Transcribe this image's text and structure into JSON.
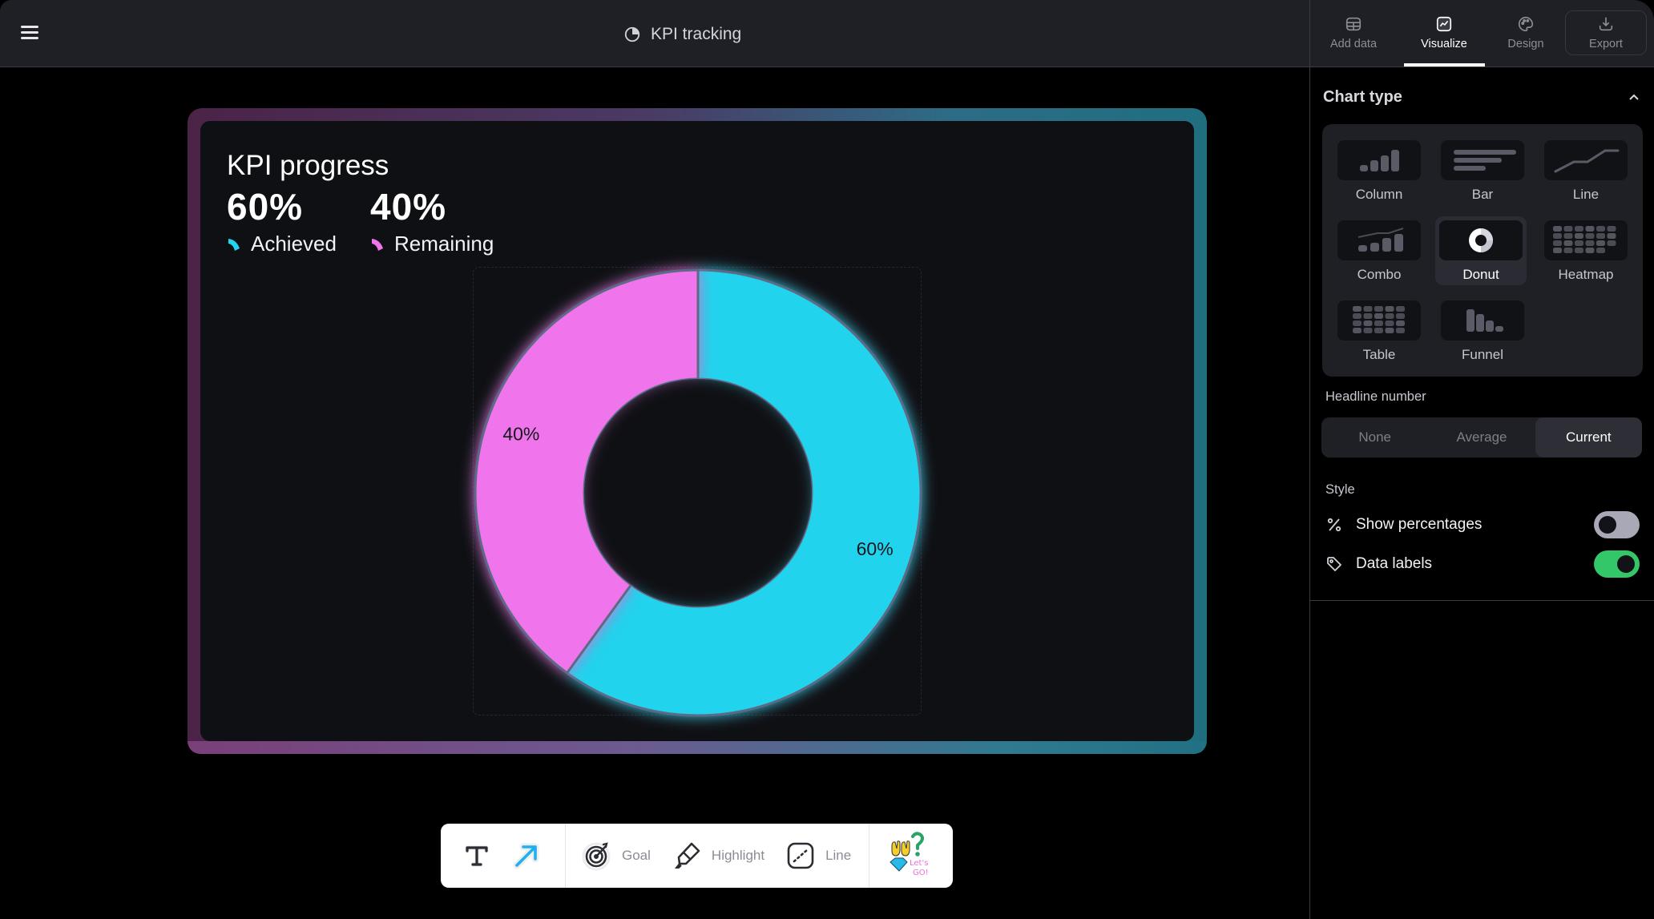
{
  "header": {
    "menu_icon": "hamburger-icon",
    "doc_icon": "pie-chart-icon",
    "title": "KPI tracking"
  },
  "panel_tabs": [
    {
      "label": "Add data",
      "icon": "table-icon",
      "active": false
    },
    {
      "label": "Visualize",
      "icon": "line-chart-icon",
      "active": true
    },
    {
      "label": "Design",
      "icon": "palette-icon",
      "active": false
    },
    {
      "label": "Export",
      "icon": "download-icon",
      "active": false
    }
  ],
  "chart_type": {
    "title": "Chart type",
    "collapse_icon": "chevron-up-icon",
    "options": [
      {
        "label": "Column",
        "selected": false
      },
      {
        "label": "Bar",
        "selected": false
      },
      {
        "label": "Line",
        "selected": false
      },
      {
        "label": "Combo",
        "selected": false
      },
      {
        "label": "Donut",
        "selected": true
      },
      {
        "label": "Heatmap",
        "selected": false
      },
      {
        "label": "Table",
        "selected": false
      },
      {
        "label": "Funnel",
        "selected": false
      }
    ]
  },
  "headline_number": {
    "label": "Headline number",
    "options": [
      "None",
      "Average",
      "Current"
    ],
    "selected": "Current"
  },
  "style": {
    "label": "Style",
    "options": [
      {
        "label": "Show percentages",
        "icon": "percent-icon",
        "enabled": false
      },
      {
        "label": "Data labels",
        "icon": "tag-icon",
        "enabled": true
      }
    ]
  },
  "card": {
    "title": "KPI progress",
    "kpis": [
      {
        "value": "60%",
        "label": "Achieved",
        "color": "#22d3ee"
      },
      {
        "value": "40%",
        "label": "Remaining",
        "color": "#f075ec"
      }
    ]
  },
  "chart_data": {
    "type": "pie",
    "variant": "donut",
    "title": "KPI progress",
    "categories": [
      "Achieved",
      "Remaining"
    ],
    "values": [
      60,
      40
    ],
    "unit": "%",
    "colors": [
      "#22d3ee",
      "#f075ec"
    ],
    "data_labels": [
      "60%",
      "40%"
    ],
    "start_angle_deg": 0,
    "direction": "clockwise",
    "legend": "top-left"
  },
  "toolbar": {
    "items": [
      {
        "label": "",
        "icon": "text-tool-icon"
      },
      {
        "label": "",
        "icon": "arrow-tool-icon"
      },
      {
        "label": "Goal",
        "icon": "target-icon"
      },
      {
        "label": "Highlight",
        "icon": "highlighter-icon"
      },
      {
        "label": "Line",
        "icon": "dotted-line-icon"
      },
      {
        "label": "",
        "icon": "stickers-icon"
      }
    ]
  },
  "colors": {
    "accent_cyan": "#22d3ee",
    "accent_pink": "#f075ec",
    "toggle_on": "#33c76a",
    "toggle_off": "#a9a8b6"
  }
}
